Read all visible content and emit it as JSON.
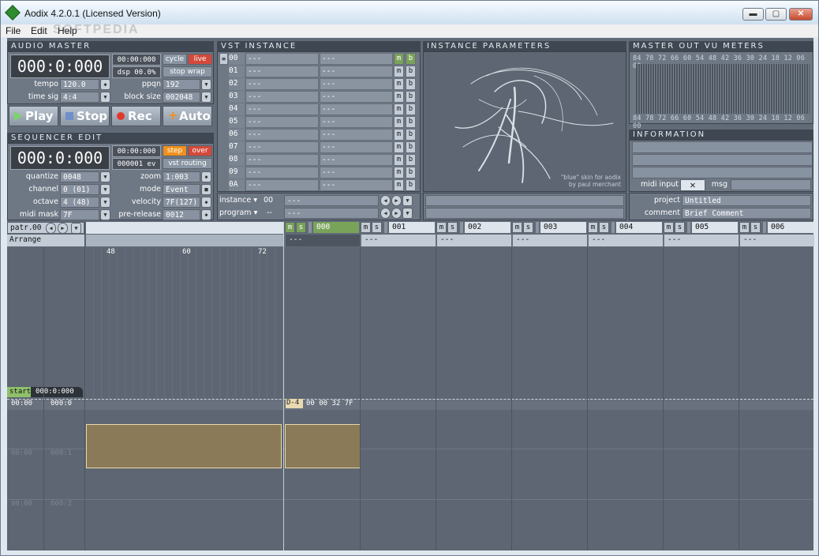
{
  "window": {
    "title": "Aodix 4.2.0.1 (Licensed Version)",
    "min": "▬",
    "max": "▢",
    "close": "✕"
  },
  "menu": {
    "file": "File",
    "edit": "Edit",
    "help": "Help"
  },
  "audio_master": {
    "title": "AUDIO MASTER",
    "time": "000:0:000",
    "clock": "00:00:000",
    "cycle": "cycle",
    "live": "live",
    "dsp": "dsp 00.0%",
    "stop_wrap": "stop wrap",
    "tempo_label": "tempo",
    "tempo": "120.0",
    "ppqn_label": "ppqn",
    "ppqn": "192",
    "timesig_label": "time sig",
    "timesig": "4:4",
    "blocksize_label": "block size",
    "blocksize": "002048"
  },
  "transport": {
    "play": "Play",
    "stop": "Stop",
    "rec": "Rec",
    "auto": "Auto"
  },
  "sequencer_edit": {
    "title": "SEQUENCER EDIT",
    "time": "000:0:000",
    "clock": "00:00:000",
    "step": "step",
    "over": "over",
    "events": "000001 ev",
    "vst_routing": "vst routing",
    "quantize_label": "quantize",
    "quantize": "0048",
    "zoom_label": "zoom",
    "zoom": "1:003",
    "channel_label": "channel",
    "channel": "0 (01)",
    "mode_label": "mode",
    "mode": "Event",
    "octave_label": "octave",
    "octave": "4 (48)",
    "velocity_label": "velocity",
    "velocity": "7F(127)",
    "midimask_label": "midi mask",
    "midimask": "7F",
    "prerelease_label": "pre-release",
    "prerelease": "0012"
  },
  "vst_instance": {
    "title": "VST INSTANCE",
    "rows": [
      {
        "num": "00",
        "a": "---",
        "b": "---"
      },
      {
        "num": "01",
        "a": "---",
        "b": "---"
      },
      {
        "num": "02",
        "a": "---",
        "b": "---"
      },
      {
        "num": "03",
        "a": "---",
        "b": "---"
      },
      {
        "num": "04",
        "a": "---",
        "b": "---"
      },
      {
        "num": "05",
        "a": "---",
        "b": "---"
      },
      {
        "num": "06",
        "a": "---",
        "b": "---"
      },
      {
        "num": "07",
        "a": "---",
        "b": "---"
      },
      {
        "num": "08",
        "a": "---",
        "b": "---"
      },
      {
        "num": "09",
        "a": "---",
        "b": "---"
      },
      {
        "num": "0A",
        "a": "---",
        "b": "---"
      }
    ],
    "m": "m",
    "b": "b",
    "instance_label": "instance ▾",
    "instance_num": "00",
    "instance_val": "---",
    "program_label": "program ▾",
    "program_num": "--",
    "program_val": "---"
  },
  "instance_parameters": {
    "title": "INSTANCE PARAMETERS",
    "credit1": "\"blue\" skin for aodix",
    "credit2": "by paul merchant"
  },
  "vu": {
    "title": "MASTER OUT VU METERS",
    "scale": "84 78 72 66 60 54 48 42 36 30 24 18 12 06 00"
  },
  "information": {
    "title": "INFORMATION",
    "midi_input": "midi input",
    "msg": "msg",
    "project_label": "project",
    "project": "Untitled",
    "comment_label": "comment",
    "comment": "Brief Comment"
  },
  "pattern": {
    "label": "patr.",
    "value": "00",
    "arrange": "Arrange",
    "ruler": [
      "48",
      "60",
      "72"
    ],
    "start_label": "start",
    "start_value": "000:0:000",
    "time_rows": [
      {
        "a": "00:00",
        "b": "000:0"
      },
      {
        "a": "00:00",
        "b": "000:1"
      },
      {
        "a": "00:00",
        "b": "000:2"
      }
    ],
    "event_note": "D-4",
    "event_data": "00 00 32 7F"
  },
  "tracks": [
    {
      "name": "000",
      "sub": "---"
    },
    {
      "name": "001",
      "sub": "---"
    },
    {
      "name": "002",
      "sub": "---"
    },
    {
      "name": "003",
      "sub": "---"
    },
    {
      "name": "004",
      "sub": "---"
    },
    {
      "name": "005",
      "sub": "---"
    },
    {
      "name": "006",
      "sub": "---"
    }
  ],
  "watermark": "SOFTPEDIA"
}
